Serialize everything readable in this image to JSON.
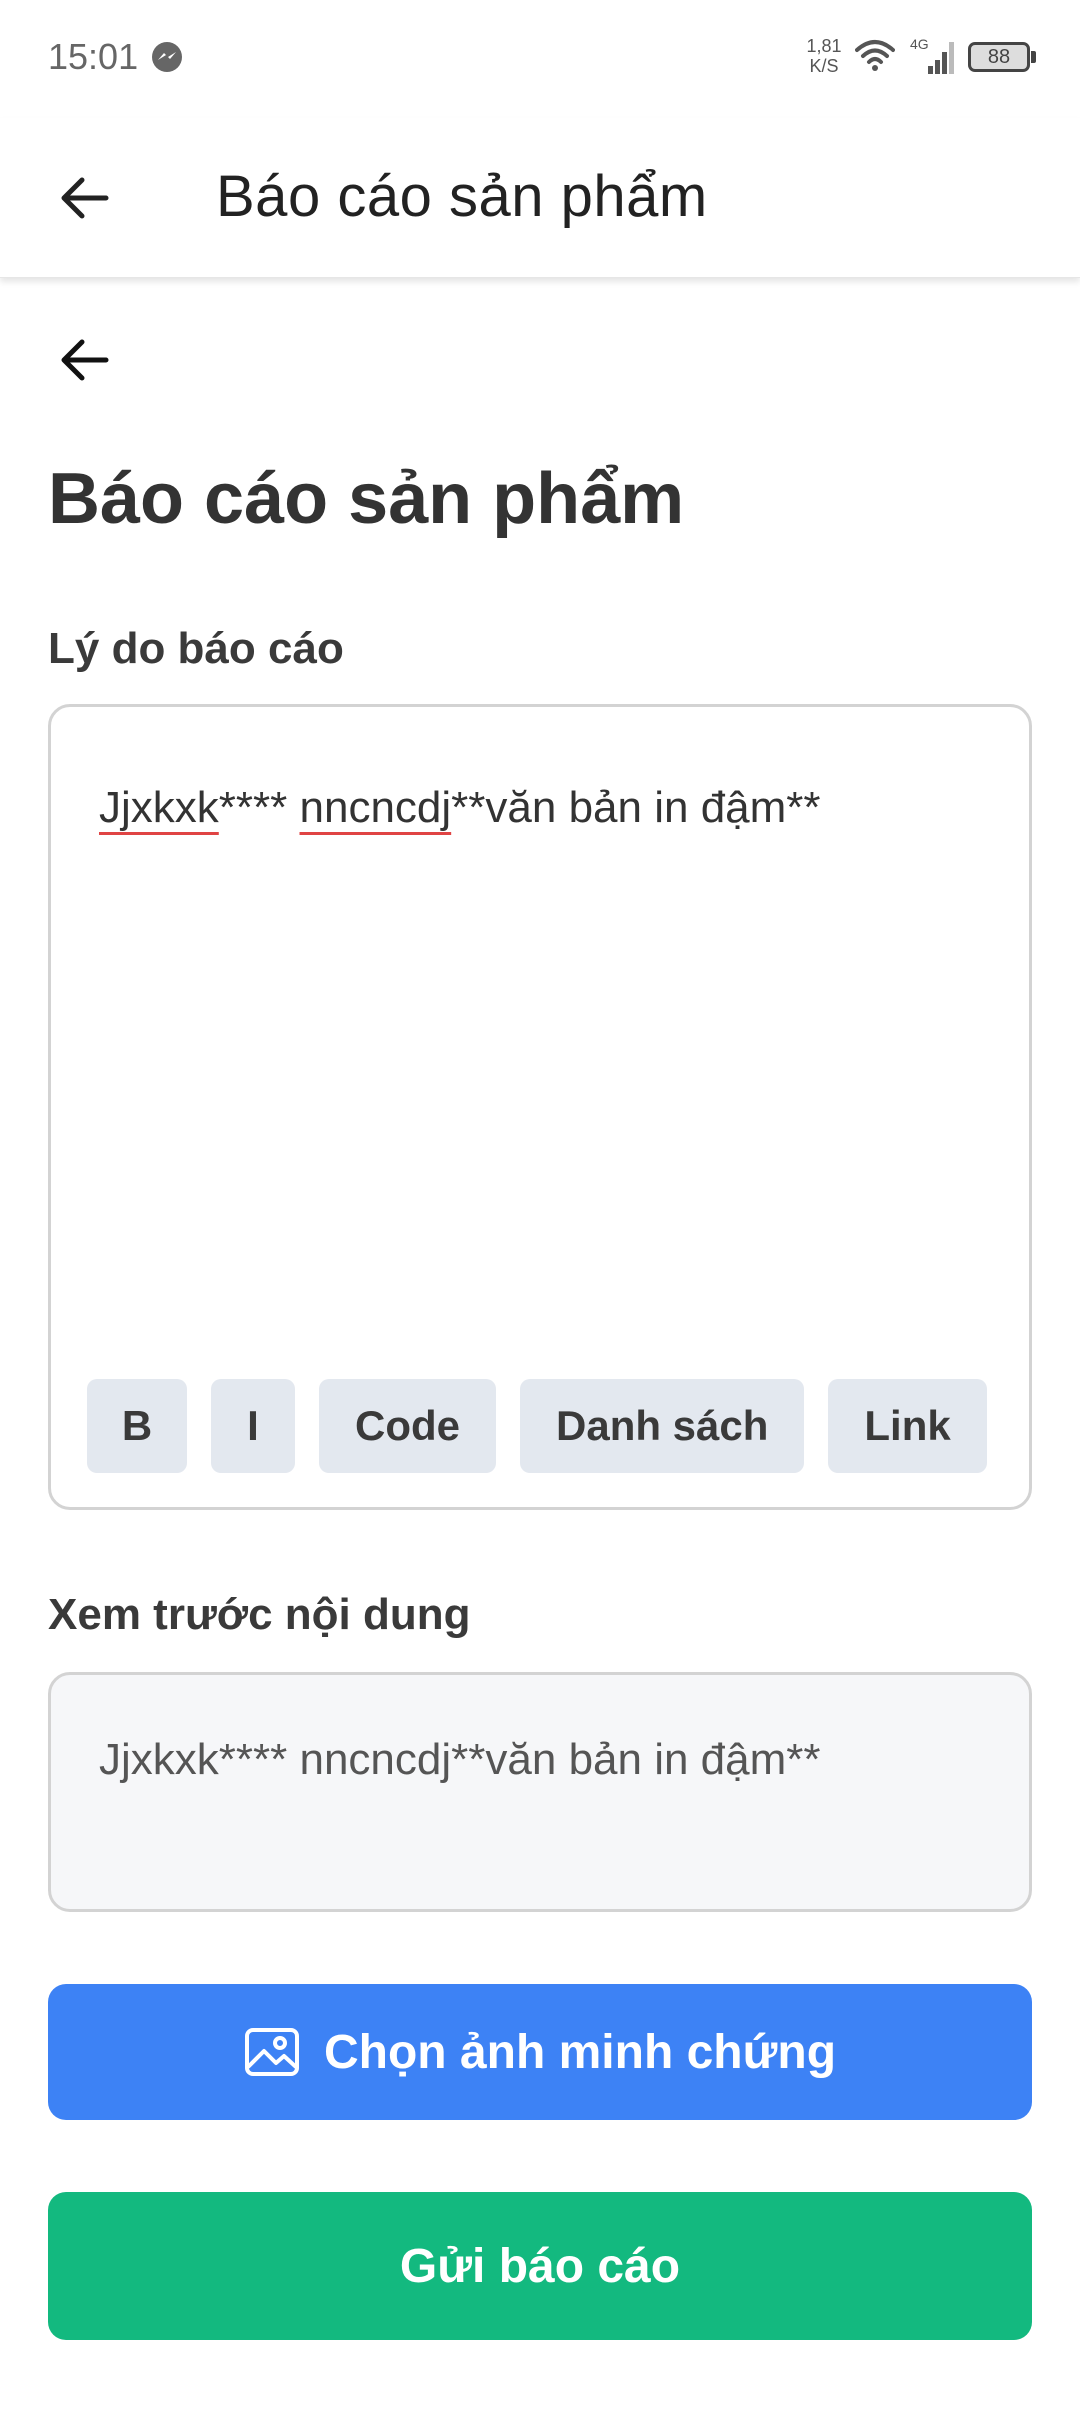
{
  "status_bar": {
    "time": "15:01",
    "net_speed_value": "1,81",
    "net_speed_unit": "K/S",
    "network": "4G",
    "battery": "88"
  },
  "app_bar": {
    "title": "Báo cáo sản phẩm"
  },
  "page": {
    "title": "Báo cáo sản phẩm"
  },
  "reason": {
    "label": "Lý do báo cáo",
    "text_part1": "Jjxkxk",
    "text_part2": "**** ",
    "text_part3": "nncncdj",
    "text_part4": "**văn bản in đậm**"
  },
  "toolbar": {
    "bold_label": "B",
    "italic_label": "I",
    "code_label": "Code",
    "list_label": "Danh sách",
    "link_label": "Link"
  },
  "preview": {
    "label": "Xem trước nội dung",
    "text": "Jjxkxk**** nncncdj**văn bản in đậm**"
  },
  "actions": {
    "choose_photo_label": "Chọn ảnh minh chứng",
    "submit_label": "Gửi báo cáo"
  },
  "colors": {
    "primary_blue": "#3d82f5",
    "submit_green": "#13b97f",
    "spell_underline": "#e04444"
  }
}
